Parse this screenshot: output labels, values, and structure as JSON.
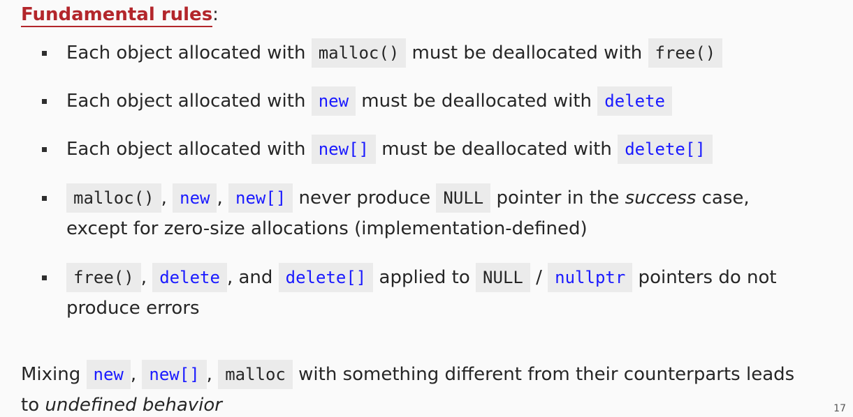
{
  "heading": {
    "label": "Fundamental rules",
    "suffix": ":"
  },
  "rules": {
    "r1": {
      "t1": "Each object allocated with ",
      "c1": "malloc()",
      "t2": " must be deallocated with ",
      "c2": "free()"
    },
    "r2": {
      "t1": "Each object allocated with ",
      "c1": "new",
      "t2": " must be deallocated with ",
      "c2": "delete"
    },
    "r3": {
      "t1": "Each object allocated with ",
      "c1": "new[]",
      "t2": " must be deallocated with ",
      "c2": "delete[]"
    },
    "r4": {
      "c1": "malloc()",
      "s1": ", ",
      "c2": "new",
      "s2": ", ",
      "c3": "new[]",
      "t1": " never produce ",
      "c4": "NULL",
      "t2": " pointer in the ",
      "em": "success",
      "t3": " case,",
      "line2": "except for zero-size allocations (implementation-defined)"
    },
    "r5": {
      "c1": "free()",
      "s1": ", ",
      "c2": "delete",
      "s2": ", and ",
      "c3": "delete[]",
      "t1": " applied to ",
      "c4": "NULL",
      "s3": " / ",
      "c5": "nullptr",
      "t2": " pointers do not",
      "line2": "produce errors"
    }
  },
  "footer": {
    "t1": "Mixing ",
    "c1": "new",
    "s1": ", ",
    "c2": "new[]",
    "s2": ", ",
    "c3": "malloc",
    "t2": " with something different from their counterparts leads",
    "t3": "to ",
    "em": "undefined behavior"
  },
  "page_number": "17",
  "colors": {
    "heading": "#b3262b",
    "keyword": "#1a1aff",
    "code_bg": "#ebebeb"
  }
}
